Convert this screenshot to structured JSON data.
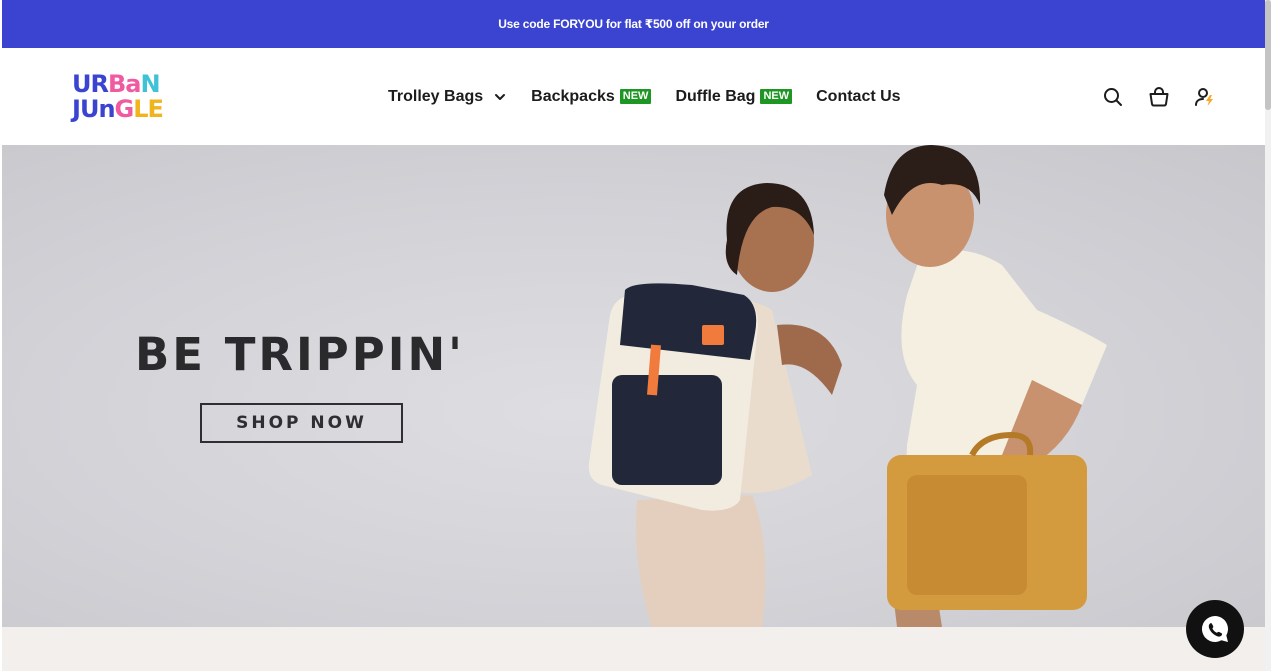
{
  "announcement": {
    "text": "Use code FORYOU for flat ₹500 off on your order"
  },
  "brand": {
    "row1": [
      "U",
      "R",
      "B",
      "a",
      "N"
    ],
    "row2": [
      "J",
      "U",
      "n",
      "G",
      "L",
      "E"
    ],
    "row1_colors": [
      "#3a44d0",
      "#3a44d0",
      "#f05aa0",
      "#f05aa0",
      "#3ec2d6"
    ],
    "row2_colors": [
      "#3a44d0",
      "#3a44d0",
      "#3a44d0",
      "#f05aa0",
      "#f0b41e",
      "#f0b41e"
    ]
  },
  "nav": {
    "items": [
      {
        "label": "Trolley Bags",
        "badge": "",
        "has_dropdown": true
      },
      {
        "label": "Backpacks",
        "badge": "NEW"
      },
      {
        "label": "Duffle Bag",
        "badge": "NEW"
      },
      {
        "label": "Contact Us",
        "badge": ""
      }
    ]
  },
  "header_icons": [
    "search-icon",
    "cart-icon",
    "account-icon"
  ],
  "hero": {
    "title": "BE TRIPPIN'",
    "cta": "SHOP NOW"
  },
  "colors": {
    "announcement_bg": "#3a44d0",
    "badge_new": "#1e9624",
    "hero_bg": "#d2d2d7",
    "bottom_band": "#f3efec"
  },
  "whatsapp": {
    "icon": "whatsapp-icon"
  }
}
